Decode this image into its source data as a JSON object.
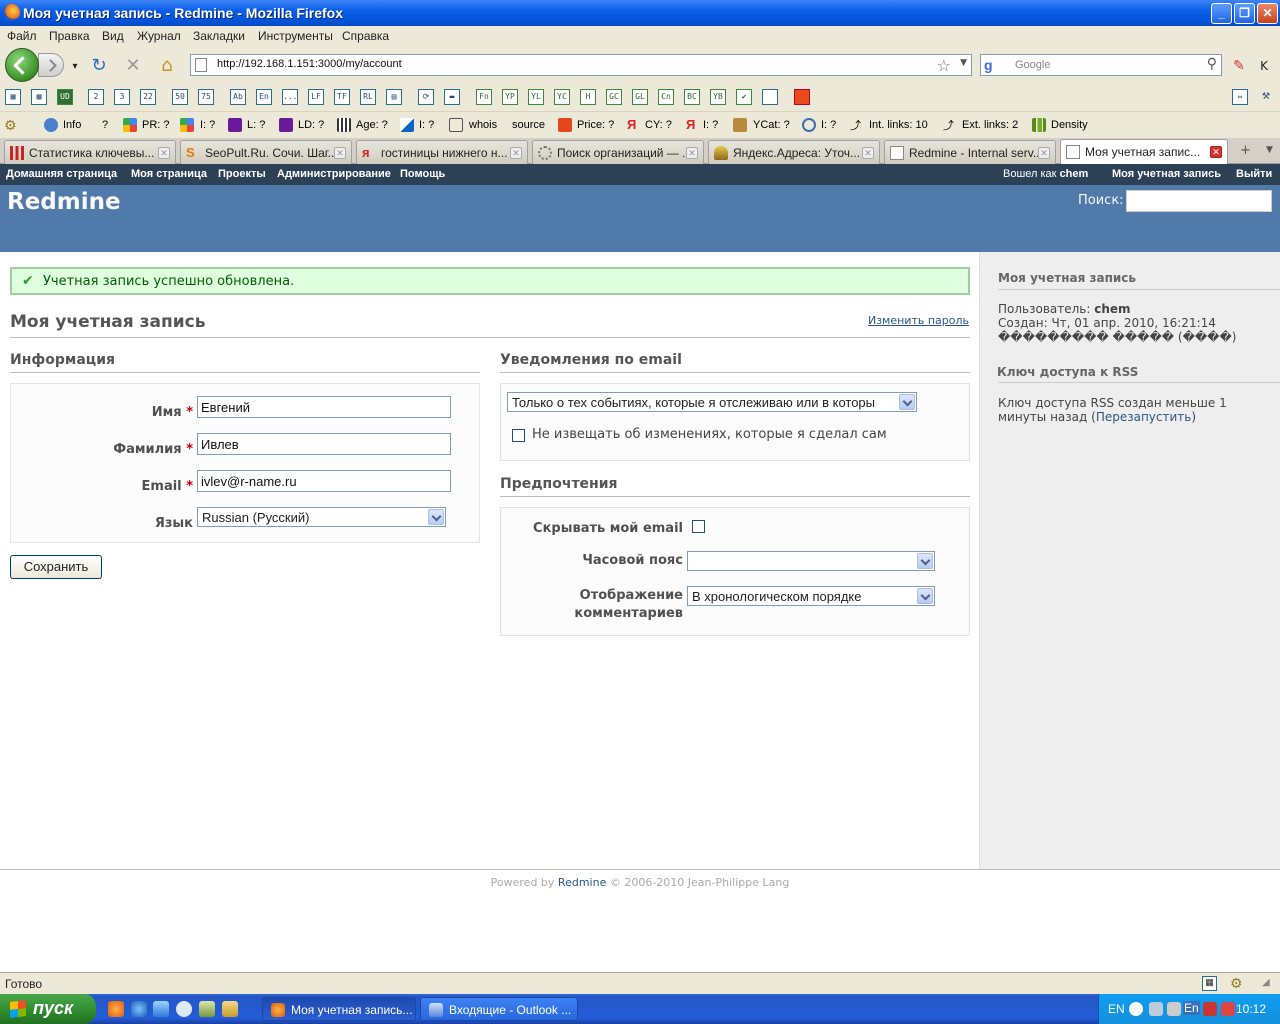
{
  "window": {
    "title": "Моя учетная запись - Redmine - Mozilla Firefox"
  },
  "menubar": [
    "Файл",
    "Правка",
    "Вид",
    "Журнал",
    "Закладки",
    "Инструменты",
    "Справка"
  ],
  "navbar": {
    "url": "http://192.168.1.151:3000/my/account",
    "search_placeholder": "Google"
  },
  "toolbar1": {
    "buttons": [
      "2",
      "3",
      "22",
      "50",
      "75",
      "Ab",
      "En",
      "...",
      "LF",
      "TF",
      "RL",
      "Fn",
      "YP",
      "YL",
      "YC",
      "H",
      "GC",
      "GL",
      "Cn",
      "BC",
      "YB"
    ]
  },
  "toolbar2": {
    "items": [
      "Info",
      "?",
      "PR: ?",
      "I: ?",
      "L: ?",
      "LD: ?",
      "Age: ?",
      "I: ?",
      "whois",
      "source",
      "Price: ?",
      "CY: ?",
      "I: ?",
      "YCat: ?",
      "I: ?",
      "Int. links: 10",
      "Ext. links: 2",
      "Density"
    ]
  },
  "tabs": [
    {
      "label": "Статистика ключевы...",
      "active": false
    },
    {
      "label": "SeoPult.Ru. Сочи. Шаг...",
      "active": false
    },
    {
      "label": "гостиницы нижнего н...",
      "active": false
    },
    {
      "label": "Поиск организаций — ...",
      "active": false
    },
    {
      "label": "Яндекс.Адреса: Уточ...",
      "active": false
    },
    {
      "label": "Redmine - Internal serv...",
      "active": false
    },
    {
      "label": "Моя учетная запис...",
      "active": true
    }
  ],
  "top_menu": {
    "home": "Домашняя страница",
    "mypage": "Моя страница",
    "projects": "Проекты",
    "admin": "Администрирование",
    "help": "Помощь",
    "logged_as_prefix": "Вошел как",
    "logged_user": "chem",
    "my_account": "Моя учетная запись",
    "logout": "Выйти"
  },
  "header": {
    "title": "Redmine",
    "search_label": "Поиск:"
  },
  "flash": {
    "notice": "Учетная запись успешно обновлена."
  },
  "page": {
    "title": "Моя учетная запись",
    "change_password": "Изменить пароль"
  },
  "info": {
    "heading": "Информация",
    "firstname_label": "Имя",
    "firstname_value": "Евгений",
    "lastname_label": "Фамилия",
    "lastname_value": "Ивлев",
    "email_label": "Email",
    "email_value": "ivlev@r-name.ru",
    "language_label": "Язык",
    "language_value": "Russian (Русский)",
    "required_mark": "*"
  },
  "save_button": "Сохранить",
  "notifications": {
    "heading": "Уведомления по email",
    "select_value": "Только о тех событиях, которые я отслеживаю или в которы",
    "no_self_notified": "Не извещать об изменениях, которые я сделал сам"
  },
  "preferences": {
    "heading": "Предпочтения",
    "hide_mail_label": "Скрывать мой email",
    "timezone_label": "Часовой пояс",
    "timezone_value": "",
    "comments_label_1": "Отображение",
    "comments_label_2": "комментариев",
    "comments_value": "В хронологическом порядке"
  },
  "sidebar": {
    "heading": "Моя учетная запись",
    "user_prefix": "Пользователь:",
    "user_value": "chem",
    "created_line": "Создан: Чт, 01 апр. 2010, 16:21:14",
    "created_garbled": "��������� ����� (����)",
    "rss_heading": "Ключ доступа к RSS",
    "rss_text_1": "Ключ доступа RSS создан меньше 1",
    "rss_text_2": "минуты назад (",
    "rss_reset": "Перезапустить",
    "rss_text_3": ")"
  },
  "footer": {
    "powered_by": "Powered by",
    "redmine": "Redmine",
    "copyright": "© 2006-2010 Jean-Philippe Lang"
  },
  "statusbar": {
    "text": "Готово"
  },
  "taskbar": {
    "start": "пуск",
    "tasks": [
      {
        "label": "Моя учетная запись...",
        "active": true
      },
      {
        "label": "Входящие - Outlook ...",
        "active": false
      }
    ],
    "lang": "EN",
    "clock": "10:12",
    "tray_lang": "En"
  },
  "colors": {
    "header_bg": "#507aaa",
    "top_menu_bg": "#2c4056",
    "flash_bg": "#dfffdf",
    "link": "#2a5685"
  }
}
